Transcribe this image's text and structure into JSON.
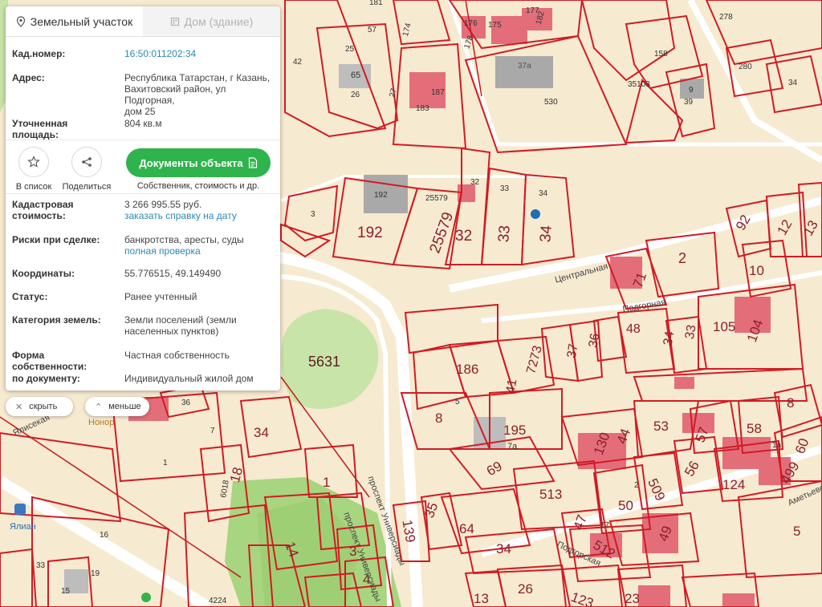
{
  "tabs": {
    "land": "Земельный участок",
    "house": "Дом (здание)"
  },
  "info": {
    "kad_label": "Кад.номер:",
    "kad_value": "16:50:011202:34",
    "address_label": "Адрес:",
    "address_line1": "Республика Татарстан, г Казань,",
    "address_line2": "Вахитовский район, ул Подгорная,",
    "address_line3": "дом 25",
    "area_label": "Уточненная площадь:",
    "area_value": "804 кв.м"
  },
  "actions": {
    "list_label": "В список",
    "share_label": "Поделиться",
    "docs_button": "Документы объекта",
    "docs_sub": "Собственник, стоимость и др."
  },
  "details": {
    "cost_label1": "Кадастровая",
    "cost_label2": "стоимость:",
    "cost_value": "3 266 995.55 руб.",
    "cost_link": "заказать справку на дату",
    "risk_label": "Риски при сделке:",
    "risk_value": "банкротства, аресты, суды",
    "risk_link": "полная проверка",
    "coord_label": "Координаты:",
    "coord_value": "55.776515, 49.149490",
    "status_label": "Статус:",
    "status_value": "Ранее учтенный",
    "category_label": "Категория земель:",
    "category_value1": "Земли поселений (земли",
    "category_value2": "населенных пунктов)",
    "ownership_label": "Форма собственности:",
    "ownership_value": "Частная собственность",
    "doc_label": "по документу:",
    "doc_value": "Индивидуальный жилой дом"
  },
  "controls": {
    "hide": "скрыть",
    "less": "меньше"
  },
  "map": {
    "streets": {
      "central": "Центральная",
      "podgornaya": "Подгорная",
      "prospekt": "проспект Универсиады",
      "prospekt2": "проспект Универсиады",
      "podgornaya2": "Подгорская",
      "ametyevo": "Аметьевс",
      "ylis": "Ялисекая",
      "honor": "Нонор"
    },
    "poi": {
      "yalian": "Ялиан"
    },
    "numbers": [
      "57",
      "174",
      "176",
      "175",
      "178",
      "177",
      "182",
      "278",
      "181",
      "25",
      "65",
      "26",
      "27",
      "187",
      "183",
      "37а",
      "530",
      "158",
      "35103",
      "280",
      "9",
      "39",
      "34",
      "192",
      "25579",
      "32",
      "33",
      "34",
      "192",
      "25579",
      "32",
      "33",
      "34",
      "3",
      "92",
      "12",
      "13",
      "10",
      "2",
      "71",
      "105",
      "104",
      "48",
      "34",
      "33",
      "37",
      "36",
      "7273",
      "186",
      "41",
      "5631",
      "8",
      "195",
      "7а",
      "69",
      "53",
      "57",
      "58",
      "60",
      "130",
      "44",
      "56",
      "499",
      "124",
      "509",
      "513",
      "50",
      "47",
      "49",
      "512",
      "35",
      "64",
      "139",
      "34",
      "26",
      "123",
      "23",
      "5",
      "13",
      "14",
      "3",
      "4",
      "1",
      "18",
      "34",
      "36",
      "7",
      "1",
      "16",
      "33",
      "19",
      "15",
      "4224",
      "6018",
      "42",
      "2",
      "8",
      "5",
      "1а",
      "17"
    ]
  }
}
